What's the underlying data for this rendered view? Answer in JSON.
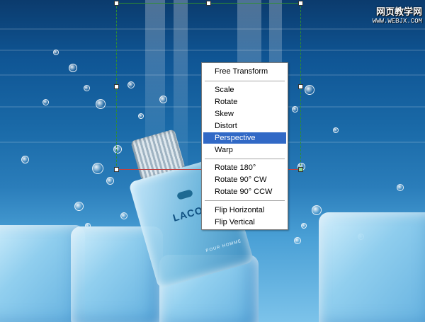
{
  "watermark": {
    "main": "网页教学网",
    "url": "WWW.WEBJX.COM"
  },
  "artwork": {
    "brand": "LACOSTE",
    "subtitle": "POUR HOMME"
  },
  "context_menu": {
    "selected": "Perspective",
    "highlight_color": "#3169c6",
    "groups": [
      [
        "Free Transform"
      ],
      [
        "Scale",
        "Rotate",
        "Skew",
        "Distort",
        "Perspective",
        "Warp"
      ],
      [
        "Rotate 180°",
        "Rotate 90° CW",
        "Rotate 90° CCW"
      ],
      [
        "Flip Horizontal",
        "Flip Vertical"
      ]
    ]
  }
}
